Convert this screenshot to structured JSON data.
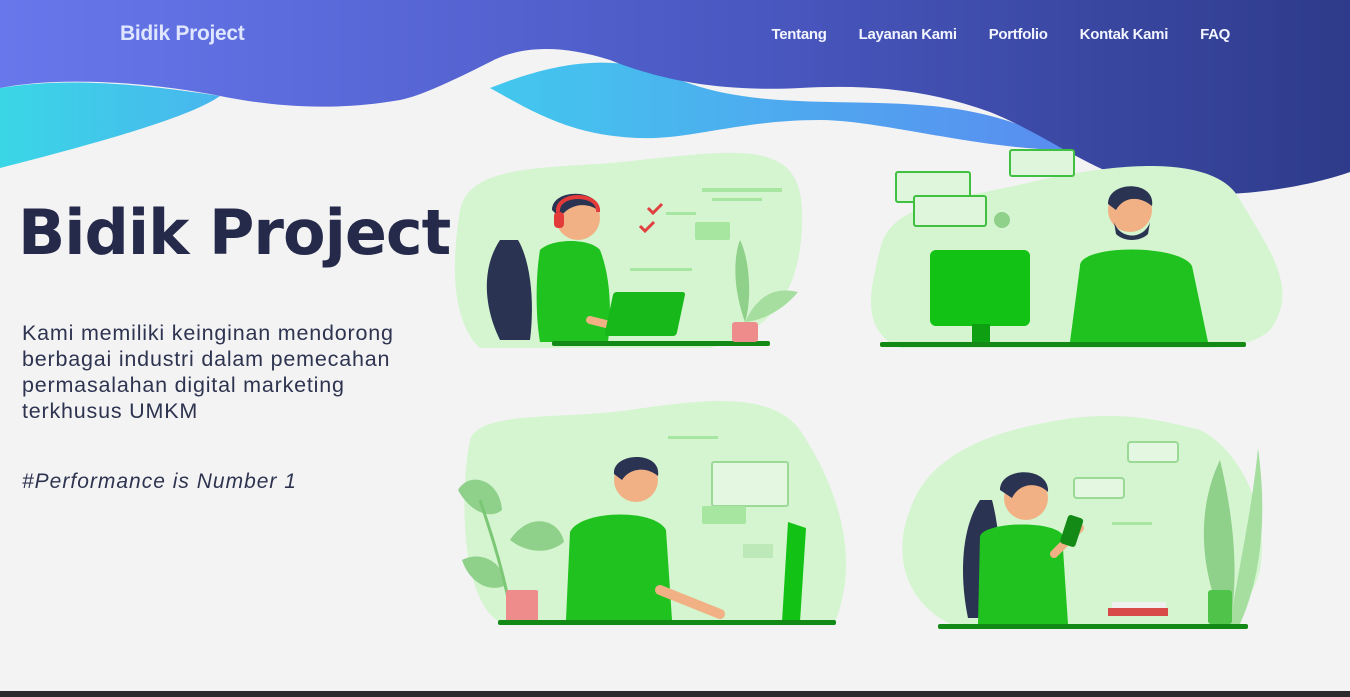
{
  "navbar": {
    "brand": "Bidik Project",
    "links": [
      "Tentang",
      "Layanan Kami",
      "Portfolio",
      "Kontak Kami",
      "FAQ"
    ]
  },
  "hero": {
    "title": "Bidik Project",
    "description": "Kami memiliki keinginan mendorong berbagai industri dalam pemecahan permasalahan digital marketing terkhusus UMKM",
    "tagline": "#Performance is Number 1"
  },
  "colors": {
    "nav_gradient_start": "#6677ea",
    "nav_gradient_end": "#2f3d8c",
    "wave_cyan": "#3fd0e6",
    "wave_blue": "#4fa0ee",
    "illustration_green": "#18c41c",
    "illustration_blob": "#d4f5cf",
    "title_color": "#262a4a"
  },
  "illustration_icons": [
    "woman-with-headset-at-laptop-icon",
    "man-at-desktop-computer-icon",
    "man-at-monitor-icon",
    "woman-with-phone-icon"
  ]
}
